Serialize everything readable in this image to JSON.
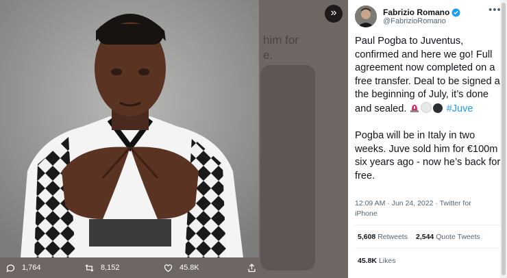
{
  "background": {
    "partial_text_line1": "him for",
    "partial_text_line2": "e."
  },
  "media": {
    "alt": "Paul Pogba in a Juventus shirt",
    "expand_icon": "chevrons-right-icon"
  },
  "actions": {
    "replies": "1,764",
    "retweets": "8,152",
    "likes": "45.8K"
  },
  "tweet": {
    "author_name": "Fabrizio Romano",
    "author_handle": "@FabrizioRomano",
    "more_label": "•••",
    "paragraph1": "Paul Pogba to Juventus, confirmed and here we go! Full agreement now completed on a free transfer. Deal to be signed at the beginning of July, it’s done and sealed.",
    "hashtag": "#Juve",
    "paragraph2": "Pogba will be in Italy in two weeks. Juve sold him for €100m six years ago - now he’s back for free.",
    "time": "12:09 AM",
    "date": "Jun 24, 2022",
    "source": "Twitter for iPhone",
    "retweets_count": "5,608",
    "retweets_label": "Retweets",
    "quotes_count": "2,544",
    "quotes_label": "Quote Tweets",
    "likes_count": "45.8K",
    "likes_label": "Likes"
  },
  "colors": {
    "accent": "#1d9bf0",
    "text": "#0f1419",
    "muted": "#536471"
  }
}
